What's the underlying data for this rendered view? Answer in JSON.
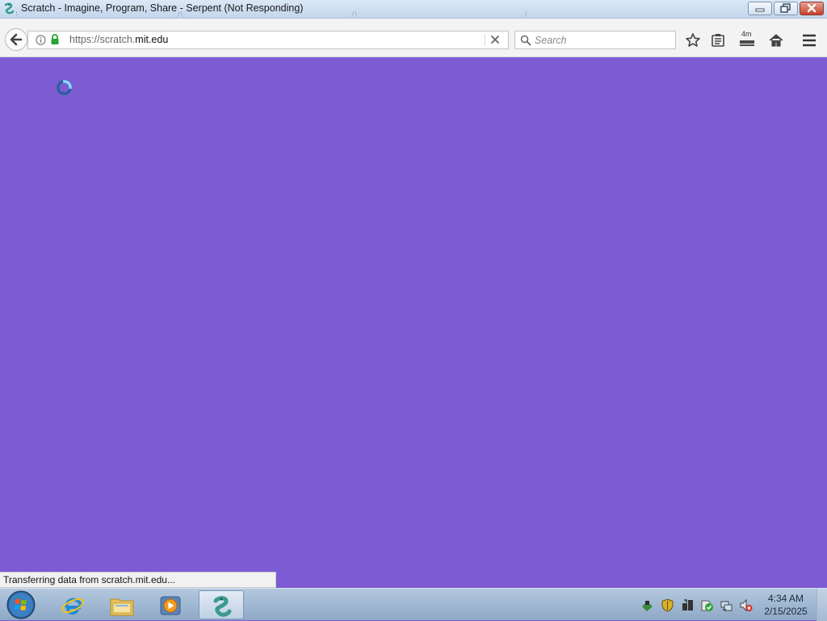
{
  "window": {
    "title": "Scratch - Imagine, Program, Share - Serpent (Not Responding)",
    "app_icon": "serpent-app-icon",
    "controls": [
      "minimize-icon",
      "restore-icon",
      "close-icon"
    ]
  },
  "toolbar": {
    "url_prefix": "https://scratch.",
    "url_domain": "mit.edu",
    "search_placeholder": "Search",
    "icons": [
      "back-arrow-icon",
      "info-icon",
      "lock-icon",
      "clear-icon",
      "search-icon",
      "bookmark-star-icon",
      "reading-list-icon",
      "downloads-icon",
      "home-icon",
      "menu-icon"
    ],
    "downloads_badge": "4m"
  },
  "content": {
    "background": "#7d5bd3",
    "loading_icon": "loading-spinner-icon"
  },
  "status": {
    "text": "Transferring data from scratch.mit.edu..."
  },
  "taskbar": {
    "start_icon": "windows-start-icon",
    "pinned": [
      "internet-explorer-icon",
      "file-explorer-icon",
      "media-player-icon",
      "serpent-browser-icon"
    ],
    "tray_icons": [
      "network-shield-icon",
      "security-shield-icon",
      "sync-icon",
      "action-center-icon",
      "network-icon",
      "volume-muted-icon"
    ],
    "clock_time": "4:34 AM",
    "clock_date": "2/15/2025"
  }
}
